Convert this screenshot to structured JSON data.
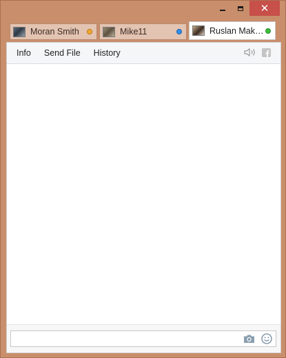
{
  "window": {
    "minimize_icon": "minimize-icon",
    "maximize_icon": "maximize-icon",
    "close_label": "✕"
  },
  "tabs": [
    {
      "label": "Moran Smith",
      "status_color": "#f2a72f",
      "avatar": "user-photo-icon"
    },
    {
      "label": "Mike11",
      "status_color": "#2f8ee8",
      "avatar": "user-photo-icon"
    },
    {
      "label": "Ruslan Mak…",
      "status_color": "#3cbf3c",
      "avatar": "user-photo-icon",
      "active": true
    }
  ],
  "toolbar": {
    "info": "Info",
    "send_file": "Send File",
    "history": "History",
    "icons": [
      "speaker-icon",
      "facebook-icon"
    ]
  },
  "composer": {
    "value": "",
    "placeholder": "",
    "icons": [
      "camera-icon",
      "smiley-icon"
    ]
  },
  "colors": {
    "frame": "#c98e6b",
    "close_button": "#c7504a",
    "tab_inactive": "#e3c3b1"
  }
}
